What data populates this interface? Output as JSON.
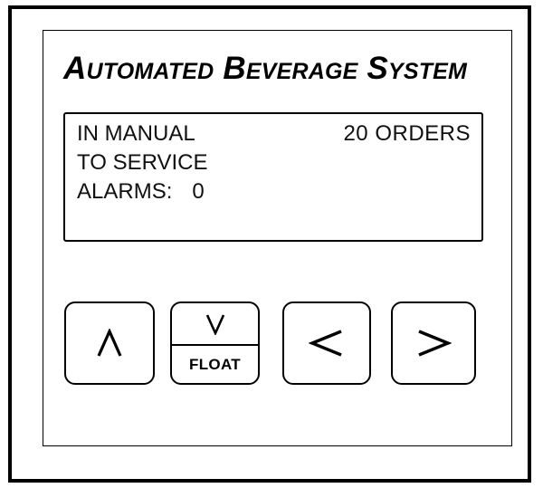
{
  "panel": {
    "title": "Automated Beverage System"
  },
  "display": {
    "line1_left": "IN MANUAL",
    "line1_right": "20 ORDERS",
    "line2": "TO SERVICE",
    "line3_label": "ALARMS:",
    "line3_value": "0"
  },
  "keys": {
    "up_icon": "caret-up",
    "down_icon": "caret-down",
    "down_label": "FLOAT",
    "left_icon": "chevron-left",
    "right_icon": "chevron-right"
  },
  "colors": {
    "background": "#ffffff",
    "outline": "#000000"
  }
}
